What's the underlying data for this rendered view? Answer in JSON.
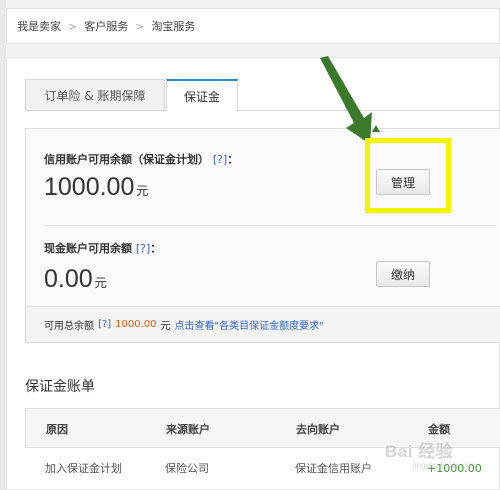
{
  "breadcrumb": {
    "items": [
      "我是卖家",
      "客户服务",
      "淘宝服务"
    ],
    "sep": ">"
  },
  "tabs": [
    {
      "label": "订单险 & 账期保障"
    },
    {
      "label": "保证金"
    }
  ],
  "credit_account": {
    "label": "信用账户可用余额（保证金计划）",
    "help": "[?]",
    "colon": "：",
    "amount": "1000.00",
    "unit": "元",
    "button": "管理"
  },
  "cash_account": {
    "label": "现金账户可用余额",
    "help": "[?]",
    "colon": "：",
    "amount": "0.00",
    "unit": "元",
    "button": "缴纳"
  },
  "total": {
    "label": "可用总余额",
    "help": "[?]",
    "amount": "1000.00",
    "unit": "元",
    "link": "点击查看\"各类目保证金额度要求\""
  },
  "ledger": {
    "title": "保证金账单",
    "columns": [
      "原因",
      "来源账户",
      "去向账户",
      "金额"
    ],
    "rows": [
      {
        "reason": "加入保证金计划",
        "source": "保险公司",
        "destination": "保证金信用账户",
        "amount": "+1000.00"
      }
    ]
  },
  "watermark": {
    "main": "Bai 经验",
    "sub": "jingyan.baidu.com"
  },
  "colors": {
    "accent": "#2a8ad2",
    "orange": "#ee5511",
    "link": "#3366cc",
    "highlight": "#f4f400",
    "arrow": "#3a7a2a"
  },
  "icons": {
    "annotation": "arrow-icon"
  }
}
